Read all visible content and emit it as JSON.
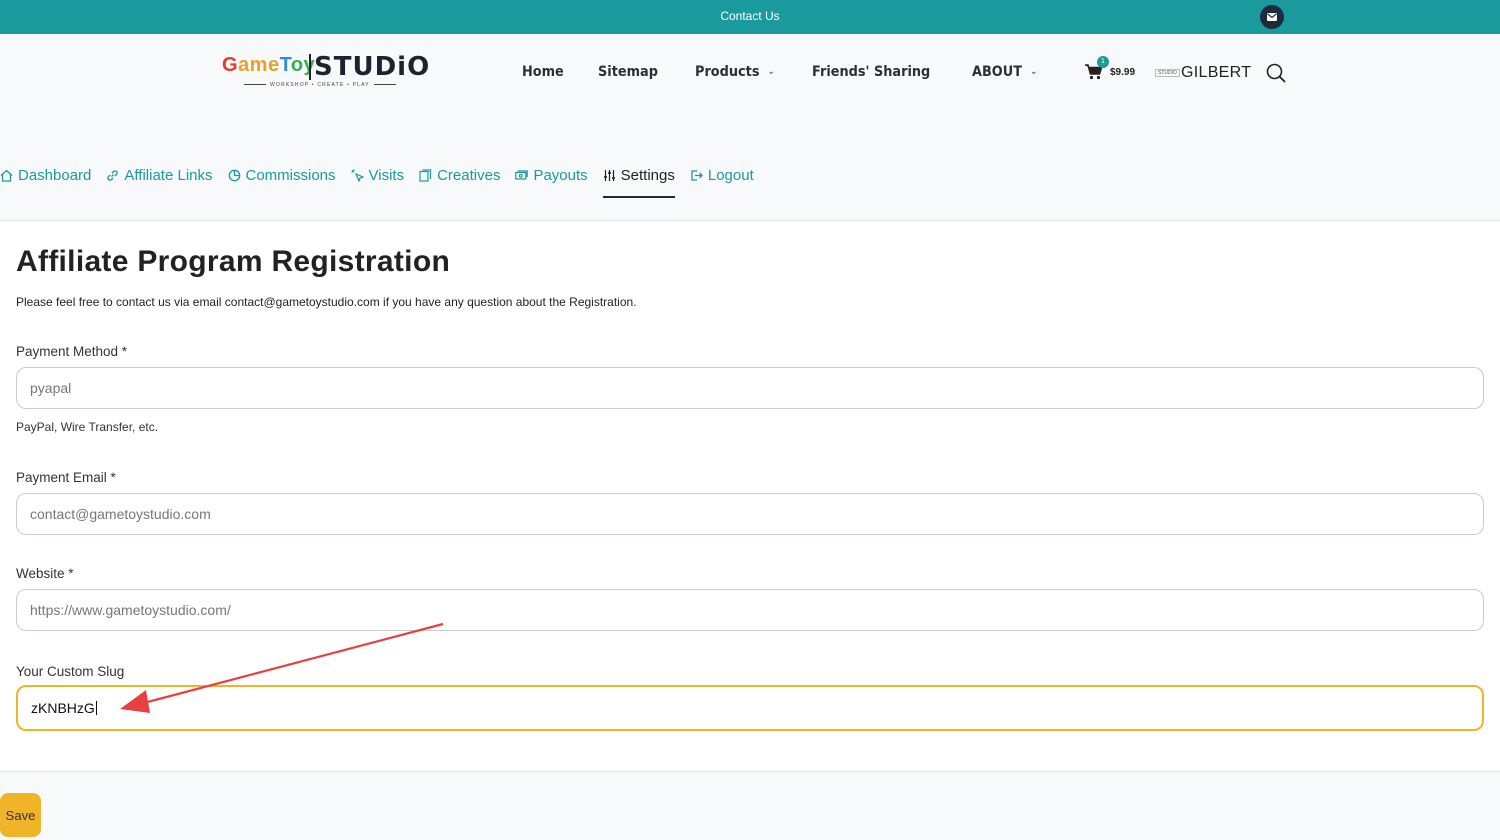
{
  "topbar": {
    "contact_label": "Contact Us",
    "mail_icon": "mail-icon"
  },
  "header": {
    "logo": {
      "word1_parts": [
        "G",
        "ame",
        "T",
        "oy"
      ],
      "word2": "STUDiO",
      "tagline": "WORKSHOP • CREATE • PLAY"
    },
    "nav": [
      {
        "label": "Home",
        "dropdown": false
      },
      {
        "label": "Sitemap",
        "dropdown": false
      },
      {
        "label": "Products",
        "dropdown": true
      },
      {
        "label": "Friends' Sharing",
        "dropdown": false
      },
      {
        "label": "ABOUT",
        "dropdown": true
      }
    ],
    "cart": {
      "count": "1",
      "price": "$9.99"
    },
    "studio_mini": "STUDIO",
    "username": "GILBERT"
  },
  "tabs": [
    {
      "label": "Dashboard",
      "icon": "home-icon",
      "active": false
    },
    {
      "label": "Affiliate Links",
      "icon": "link-icon",
      "active": false
    },
    {
      "label": "Commissions",
      "icon": "pie-chart-icon",
      "active": false
    },
    {
      "label": "Visits",
      "icon": "cursor-click-icon",
      "active": false
    },
    {
      "label": "Creatives",
      "icon": "images-icon",
      "active": false
    },
    {
      "label": "Payouts",
      "icon": "money-icon",
      "active": false
    },
    {
      "label": "Settings",
      "icon": "sliders-icon",
      "active": true
    },
    {
      "label": "Logout",
      "icon": "logout-icon",
      "active": false
    }
  ],
  "form": {
    "title": "Affiliate Program Registration",
    "intro": "Please feel free to contact us via email contact@gametoystudio.com if you have any question about the Registration.",
    "payment_method": {
      "label": "Payment Method *",
      "value": "pyapal",
      "hint": "PayPal, Wire Transfer, etc."
    },
    "payment_email": {
      "label": "Payment Email *",
      "value": "contact@gametoystudio.com"
    },
    "website": {
      "label": "Website *",
      "value": "https://www.gametoystudio.com/"
    },
    "custom_slug": {
      "label": "Your Custom Slug",
      "value": "zKNBHzG"
    },
    "save_label": "Save"
  },
  "colors": {
    "accent": "#1a9a9c",
    "focus": "#f0b429",
    "arrow": "#e84040"
  }
}
